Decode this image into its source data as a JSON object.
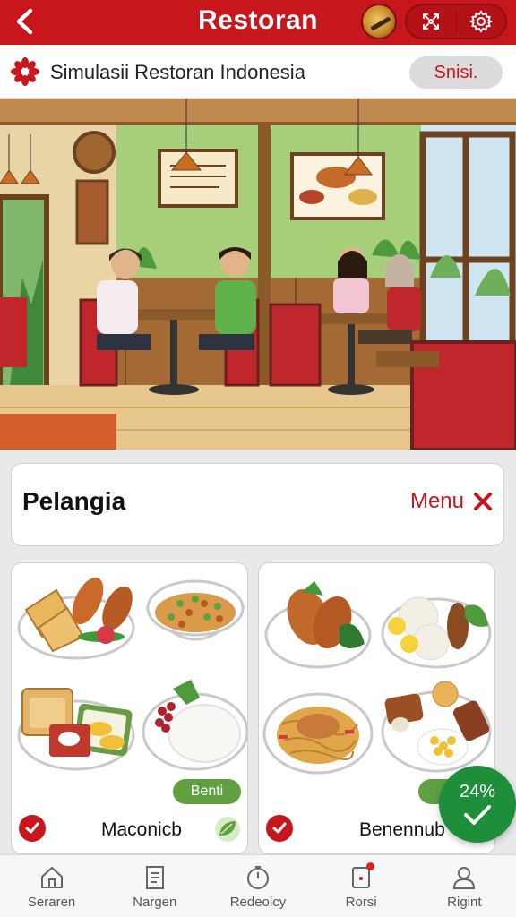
{
  "header": {
    "back_icon": "chevron-left-icon",
    "title": "Restoran",
    "action_icons": [
      "cutlery-emblem-icon",
      "gear-icon"
    ]
  },
  "subheader": {
    "logo_icon": "flower-logo-icon",
    "title": "Simulasii Restoran Indonesia",
    "button_label": "Snisi."
  },
  "scene": {
    "description_icon": "restaurant-dining-scene"
  },
  "section": {
    "title": "Pelangia",
    "menu_label": "Menu",
    "close_icon": "close-x-icon"
  },
  "cards": [
    {
      "name": "Maconicb",
      "tag": "Benti",
      "check_icon": "check-icon",
      "extra_icon": "leaf-icon"
    },
    {
      "name": "Benennub",
      "tag": "S",
      "check_icon": "check-icon"
    }
  ],
  "fab": {
    "value": "24%",
    "icon": "checkmark-icon"
  },
  "bottom_nav": [
    {
      "label": "Seraren",
      "icon": "home-icon"
    },
    {
      "label": "Nargen",
      "icon": "document-icon"
    },
    {
      "label": "Redeolcy",
      "icon": "timer-icon"
    },
    {
      "label": "Rorsi",
      "icon": "notification-card-icon",
      "badge": true
    },
    {
      "label": "Rigint",
      "icon": "user-icon"
    }
  ],
  "colors": {
    "brand": "#c8161d",
    "accent_green": "#1f8e3a",
    "tag_green": "#5fa041"
  }
}
